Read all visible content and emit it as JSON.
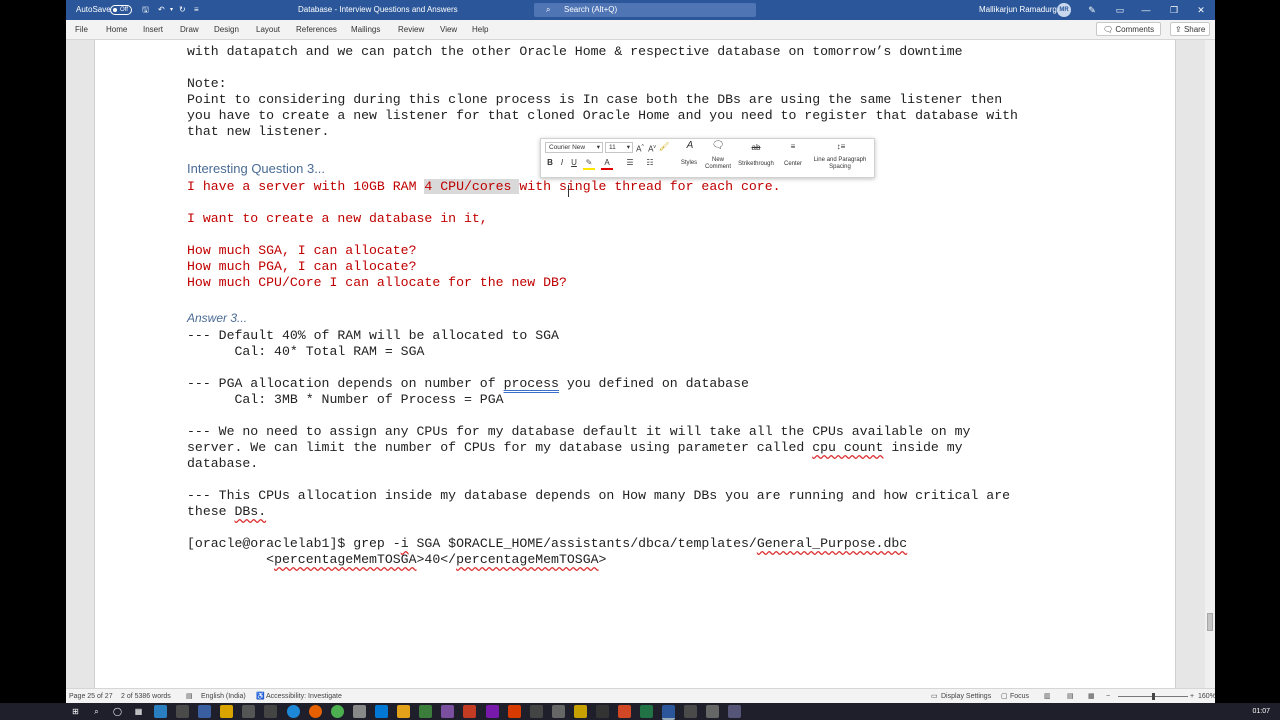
{
  "window": {
    "autosave_label": "AutoSave",
    "autosave_state": "Off",
    "title": "Database - Interview Questions and Answers",
    "search_placeholder": "Search (Alt+Q)",
    "user_name": "Mallikarjun Ramadurg",
    "user_initials": "MR"
  },
  "ribbon": {
    "tabs": [
      "File",
      "Home",
      "Insert",
      "Draw",
      "Design",
      "Layout",
      "References",
      "Mailings",
      "Review",
      "View",
      "Help"
    ],
    "comments_label": "Comments",
    "share_label": "Share"
  },
  "mini_toolbar": {
    "font_name": "Courier New",
    "font_size": "11",
    "bold": "B",
    "italic": "I",
    "underline": "U",
    "styles_label": "Styles",
    "new_comment_label_1": "New",
    "new_comment_label_2": "Comment",
    "strikethrough_label": "Strikethrough",
    "center_label": "Center",
    "spacing_label_1": "Line and Paragraph",
    "spacing_label_2": "Spacing"
  },
  "document": {
    "line_top": "with datapatch and we can patch the other Oracle Home & respective database on tomorrow’s downtime",
    "note_label": "Note:",
    "note_1": "Point to considering during this clone process is In case both the DBs are using the same listener then",
    "note_2": "you have to create a new listener for that cloned Oracle Home and you need to register that database with",
    "note_3": "that new listener.",
    "q_heading": "Interesting Question 3...",
    "q1_a": "I have a server with 10GB RAM ",
    "q1_hl": "4 CPU/cores ",
    "q1_b": "with single thread for each core.",
    "q2": "I want to create a new database in it,",
    "q3": "How much SGA, I can allocate?",
    "q4": "How much PGA, I can allocate?",
    "q5": "How much CPU/Core I can allocate for the new DB?",
    "a_heading": "Answer 3...",
    "a1": "--- Default 40% of RAM will be allocated to SGA",
    "a1_cal": "      Cal: 40* Total RAM = SGA",
    "a2_a": "--- PGA allocation depends on number of ",
    "a2_word": "process",
    "a2_b": " you defined on database",
    "a2_cal": "      Cal: 3MB * Number of Process = PGA",
    "a3_1": "--- We no need to assign any CPUs for my database default it will take all the CPUs available on my",
    "a3_2a": "server. We can limit the number of CPUs for my database using parameter called ",
    "a3_2w": "cpu count",
    "a3_2b": " inside my",
    "a3_3": "database.",
    "a4_1": "--- This CPUs allocation inside my database depends on How many DBs you are running and how critical are",
    "a4_2a": "these ",
    "a4_2w": "DBs.",
    "cmd_a": "[oracle@oraclelab1]$ grep -",
    "cmd_i": "i",
    "cmd_b": " SGA $ORACLE_HOME/assistants/dbca/templates/",
    "cmd_file": "General_Purpose.dbc",
    "xml_indent": "          <",
    "xml_tag1": "percentageMemTOSGA",
    "xml_mid": ">40</",
    "xml_tag2": "percentageMemTOSGA",
    "xml_end": ">"
  },
  "status": {
    "page": "Page 25 of 27",
    "words": "2 of 5386 words",
    "language": "English (India)",
    "accessibility": "Accessibility: Investigate",
    "display_settings": "Display Settings",
    "focus": "Focus",
    "zoom": "160%",
    "zoom_fraction": 0.5
  },
  "taskbar": {
    "clock": "01:07"
  }
}
